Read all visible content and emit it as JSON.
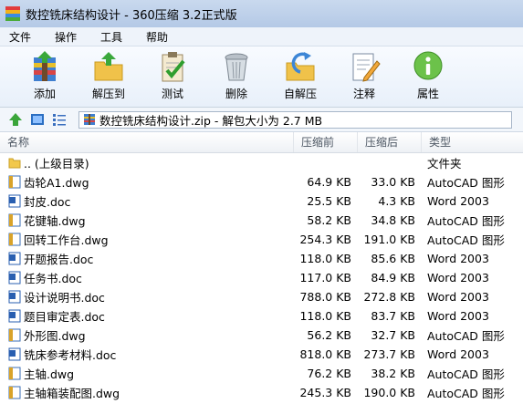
{
  "window": {
    "title": "数控铣床结构设计 - 360压缩 3.2正式版"
  },
  "menu": [
    "文件",
    "操作",
    "工具",
    "帮助"
  ],
  "toolbar": [
    {
      "label": "添加",
      "icon": "add-icon"
    },
    {
      "label": "解压到",
      "icon": "extract-folder-icon"
    },
    {
      "label": "测试",
      "icon": "test-clipboard-icon"
    },
    {
      "label": "删除",
      "icon": "trash-icon"
    },
    {
      "label": "自解压",
      "icon": "sfx-icon"
    },
    {
      "label": "注释",
      "icon": "comment-icon"
    },
    {
      "label": "属性",
      "icon": "info-icon"
    }
  ],
  "address": {
    "text": "数控铣床结构设计.zip - 解包大小为 2.7 MB"
  },
  "columns": {
    "name": "名称",
    "compressed": "压缩前",
    "size": "压缩后",
    "type": "类型"
  },
  "files": [
    {
      "name": ".. (上级目录)",
      "compressed": "",
      "size": "",
      "type": "文件夹",
      "kind": "folder"
    },
    {
      "name": "齿轮A1.dwg",
      "compressed": "64.9 KB",
      "size": "33.0 KB",
      "type": "AutoCAD 图形",
      "kind": "dwg"
    },
    {
      "name": "封皮.doc",
      "compressed": "25.5 KB",
      "size": "4.3 KB",
      "type": "Word 2003",
      "kind": "doc"
    },
    {
      "name": "花键轴.dwg",
      "compressed": "58.2 KB",
      "size": "34.8 KB",
      "type": "AutoCAD 图形",
      "kind": "dwg"
    },
    {
      "name": "回转工作台.dwg",
      "compressed": "254.3 KB",
      "size": "191.0 KB",
      "type": "AutoCAD 图形",
      "kind": "dwg"
    },
    {
      "name": "开题报告.doc",
      "compressed": "118.0 KB",
      "size": "85.6 KB",
      "type": "Word 2003",
      "kind": "doc"
    },
    {
      "name": "任务书.doc",
      "compressed": "117.0 KB",
      "size": "84.9 KB",
      "type": "Word 2003",
      "kind": "doc"
    },
    {
      "name": "设计说明书.doc",
      "compressed": "788.0 KB",
      "size": "272.8 KB",
      "type": "Word 2003",
      "kind": "doc"
    },
    {
      "name": "题目审定表.doc",
      "compressed": "118.0 KB",
      "size": "83.7 KB",
      "type": "Word 2003",
      "kind": "doc"
    },
    {
      "name": "外形图.dwg",
      "compressed": "56.2 KB",
      "size": "32.7 KB",
      "type": "AutoCAD 图形",
      "kind": "dwg"
    },
    {
      "name": "铣床参考材料.doc",
      "compressed": "818.0 KB",
      "size": "273.7 KB",
      "type": "Word 2003",
      "kind": "doc"
    },
    {
      "name": "主轴.dwg",
      "compressed": "76.2 KB",
      "size": "38.2 KB",
      "type": "AutoCAD 图形",
      "kind": "dwg"
    },
    {
      "name": "主轴箱装配图.dwg",
      "compressed": "245.3 KB",
      "size": "190.0 KB",
      "type": "AutoCAD 图形",
      "kind": "dwg"
    }
  ]
}
